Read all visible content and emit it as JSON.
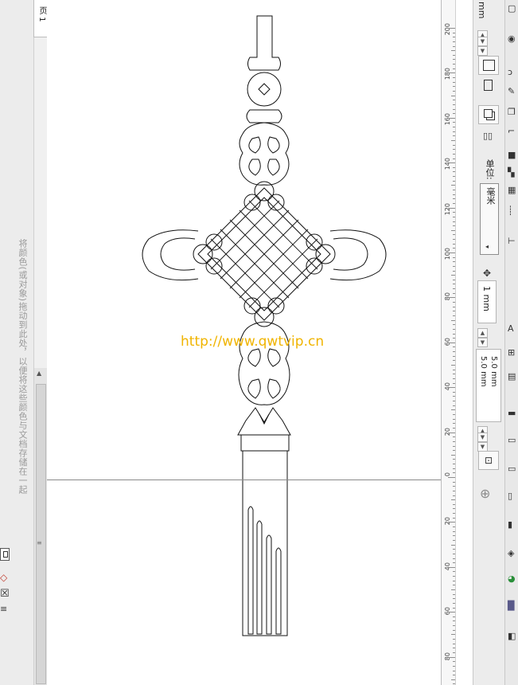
{
  "document": {
    "page_tab_label": "页 1"
  },
  "hint": {
    "text": "将颜色(或对象)拖动到此处，以便将这些颜色与文档存储在一起"
  },
  "watermark": {
    "text": "http://www.qwtvip.cn"
  },
  "ruler": {
    "labels": [
      "200",
      "180",
      "160",
      "140",
      "120",
      "100",
      "80",
      "60",
      "40",
      "20",
      "0",
      "20",
      "40",
      "60",
      "80"
    ]
  },
  "properties": {
    "top_value": "mm",
    "unit_label": "单位:",
    "unit_value": "毫米",
    "nudge_value": "1 mm",
    "duplicate_x": "5.0 mm",
    "duplicate_y": "5.0 mm"
  },
  "colors": {
    "guide": "#8a8a8a",
    "watermark": "#f0b400"
  }
}
